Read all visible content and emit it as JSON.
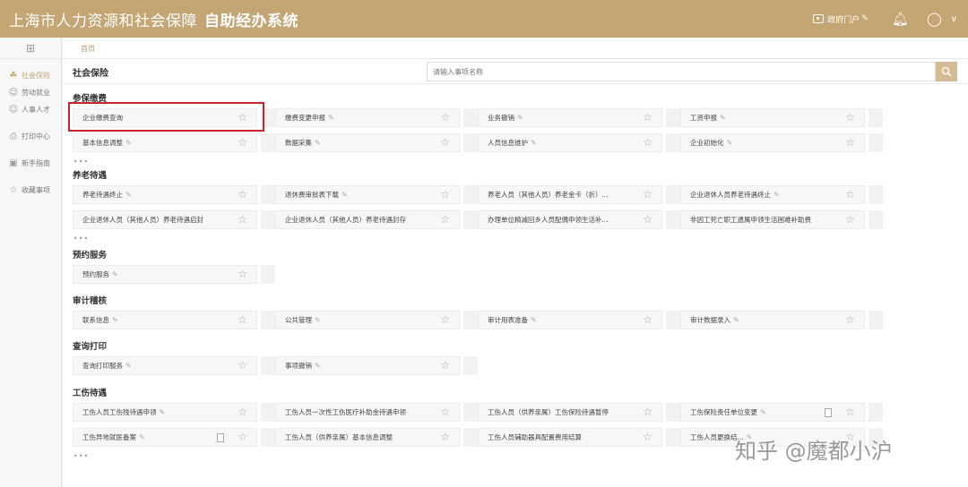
{
  "header": {
    "org_title": "上海市人力资源和社会保障",
    "system_title": "自助经办系统",
    "portal_label": "政府门户",
    "brand_color": "#c4a574"
  },
  "sidebar": {
    "grid_icon": "grid-icon",
    "items": [
      {
        "label": "社会保险",
        "icon": "insurance-icon",
        "active": true
      },
      {
        "label": "劳动就业",
        "icon": "user-icon",
        "active": false
      },
      {
        "label": "人事人才",
        "icon": "user-icon",
        "active": false
      },
      {
        "label": "打印中心",
        "icon": "printer-icon",
        "active": false
      },
      {
        "label": "新手指南",
        "icon": "guide-icon",
        "active": false
      },
      {
        "label": "收藏事项",
        "icon": "star-icon",
        "active": false
      }
    ]
  },
  "breadcrumb": "首页",
  "category": "社会保险",
  "search": {
    "placeholder": "请输入事项名称"
  },
  "sections": [
    {
      "title": "参保缴费",
      "items": [
        [
          "企业缴费查询",
          "缴费变更申报",
          "业务撤销",
          "工资申报"
        ],
        [
          "基本信息调整",
          "数据采集",
          "人员信息维护",
          "企业初始化"
        ]
      ],
      "more": "•••"
    },
    {
      "title": "养老待遇",
      "items": [
        [
          "养老待遇终止",
          "退休费审批表下载",
          "养老人员（其他人员）养老金卡（折）...",
          "企业退休人员养老待遇终止"
        ],
        [
          "企业退休人员（其他人员）养老待遇启封",
          "企业退休人员（其他人员）养老待遇封存",
          "办理单位精减回乡人员配偶申领生活补...",
          "非因工死亡职工遗属申领生活困难补助费"
        ]
      ],
      "more": "•••"
    },
    {
      "title": "预约服务",
      "items": [
        [
          "预约服务"
        ]
      ]
    },
    {
      "title": "审计稽核",
      "items": [
        [
          "联系信息",
          "公共管理",
          "审计用表准备",
          "审计数据录入"
        ]
      ]
    },
    {
      "title": "查询打印",
      "items": [
        [
          "查询打印服务",
          "事项撤销"
        ]
      ]
    },
    {
      "title": "工伤待遇",
      "items": [
        [
          "工伤人员工伤残待遇申领",
          "工伤人员一次性工伤医疗补助金待遇申领",
          "工伤人员（供养亲属）工伤保险待遇暂停",
          "工伤保险责任单位变更"
        ],
        [
          "工伤异地就医备案",
          "工伤人员（供养亲属）基本信息调整",
          "工伤人员辅助器具配置费用结算",
          "工伤人员更换结..."
        ]
      ],
      "more": "•••"
    }
  ],
  "watermark": "知乎 @魔都小沪",
  "highlight_color": "#c8252c"
}
